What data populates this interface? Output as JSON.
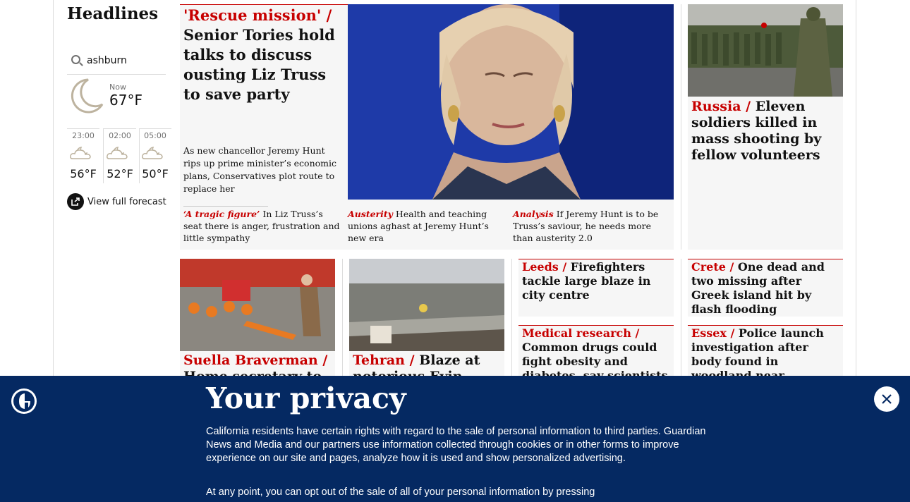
{
  "colors": {
    "news_red": "#c70000",
    "banner_bg": "#052962",
    "card_bg": "#f6f6f6"
  },
  "sidebar": {
    "title": "Headlines",
    "weather": {
      "location": "ashburn",
      "now_label": "Now",
      "now_temp": "67°F",
      "now_icon": "moon-icon",
      "forecast": [
        {
          "time": "23:00",
          "temp": "56°F",
          "icon": "cloud-moon-icon"
        },
        {
          "time": "02:00",
          "temp": "52°F",
          "icon": "cloud-moon-icon"
        },
        {
          "time": "05:00",
          "temp": "50°F",
          "icon": "cloud-moon-icon"
        }
      ],
      "full_forecast_label": "View full forecast"
    }
  },
  "lead": {
    "kicker": "'Rescue mission' /",
    "headline": "Senior Tories hold talks to discuss ousting Liz Truss to save party",
    "standfirst": "As new chancellor Jeremy Hunt rips up prime minister’s economic plans, Conservatives plot route to replace her",
    "sublinks": [
      {
        "kicker": "‘A tragic figure’",
        "text": "In Liz Truss’s seat there is anger, frustration and little sympathy"
      },
      {
        "kicker": "Austerity",
        "text": "Health and teaching unions aghast at Jeremy Hunt’s new era"
      },
      {
        "kicker": "Analysis",
        "text": "If Jeremy Hunt is to be Truss’s saviour, he needs more than austerity 2.0"
      }
    ]
  },
  "right_top": {
    "kicker": "Russia /",
    "headline": "Eleven soldiers killed in mass shooting by fellow volunteers"
  },
  "row2": [
    {
      "kicker": "Suella Braverman /",
      "headline": "Home secretary to"
    },
    {
      "kicker": "Tehran /",
      "headline": "Blaze at notorious Evin prison"
    },
    {
      "kicker": "Leeds /",
      "headline": "Firefighters tackle large blaze in city centre"
    },
    {
      "kicker": "Crete /",
      "headline": "One dead and two missing after Greek island hit by flash flooding"
    },
    {
      "kicker": "Medical research /",
      "headline": "Common drugs could fight obesity and diabetes, say scientists"
    },
    {
      "kicker": "Essex /",
      "headline": "Police launch investigation after body found in woodland near Loughton"
    }
  ],
  "privacy": {
    "title": "Your privacy",
    "para1": "California residents have certain rights with regard to the sale of personal information to third parties. Guardian News and Media and our partners use information collected through cookies or in other forms to improve experience on our site and pages, analyze how it is used and show personalized advertising.",
    "para2": "At any point, you can opt out of the sale of all of your personal information by pressing"
  }
}
